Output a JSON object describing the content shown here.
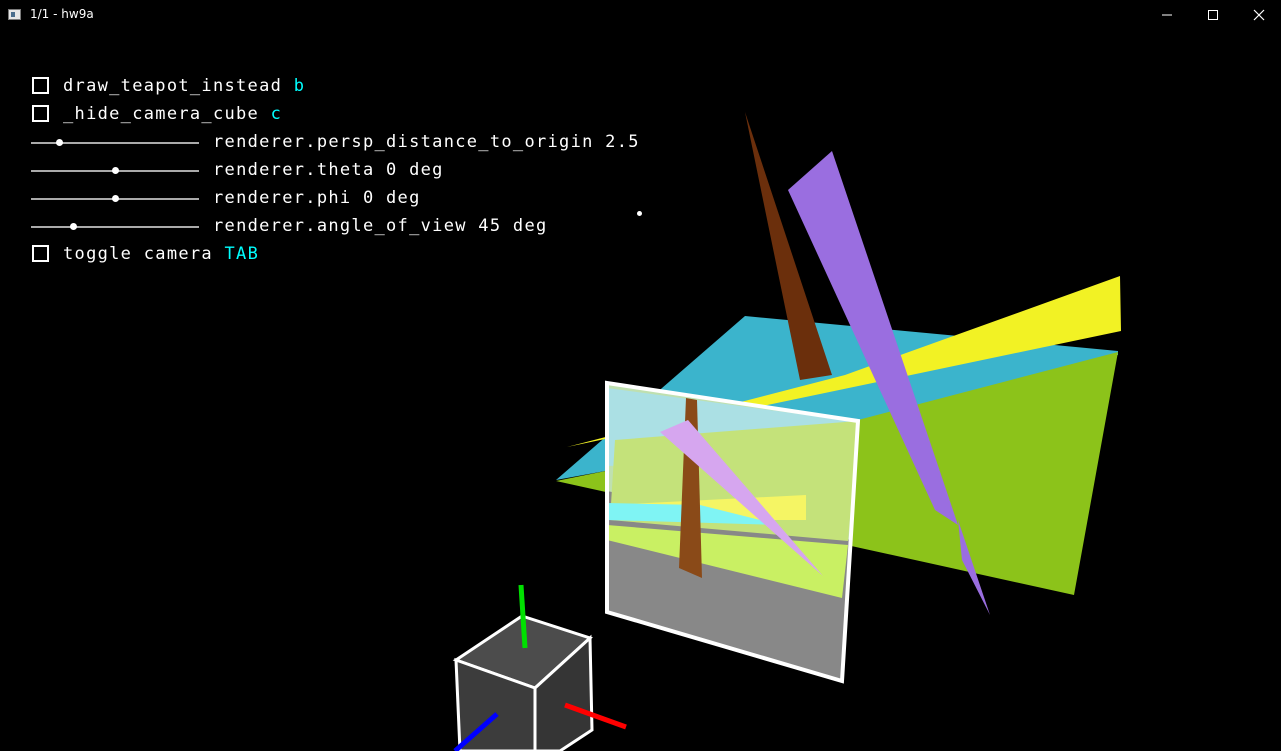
{
  "window": {
    "title": "1/1 - hw9a"
  },
  "controls": {
    "draw_teapot": {
      "label": "draw_teapot_instead",
      "key": "b",
      "checked": false
    },
    "hide_camera_cube": {
      "label": "_hide_camera_cube",
      "key": "c",
      "checked": false
    },
    "sliders": [
      {
        "label": "renderer.persp_distance_to_origin 2.5",
        "value_fraction": 0.17
      },
      {
        "label": "renderer.theta 0 deg",
        "value_fraction": 0.5
      },
      {
        "label": "renderer.phi 0 deg",
        "value_fraction": 0.5
      },
      {
        "label": "renderer.angle_of_view 45 deg",
        "value_fraction": 0.25
      }
    ],
    "toggle_camera": {
      "label": "toggle camera",
      "key": "TAB",
      "checked": false
    }
  },
  "scene": {
    "colors": {
      "cyan_plane": "#3bb4cc",
      "green_plane": "#8cc31a",
      "yellow_plane": "#f2f224",
      "purple_spike": "#9a6ee0",
      "brown_spike": "#6b2f0c",
      "camera_frame": "#ffffff",
      "axis_x": "#ff0000",
      "axis_y": "#00e000",
      "axis_z": "#0000ff",
      "cube_face": "#454545"
    }
  }
}
